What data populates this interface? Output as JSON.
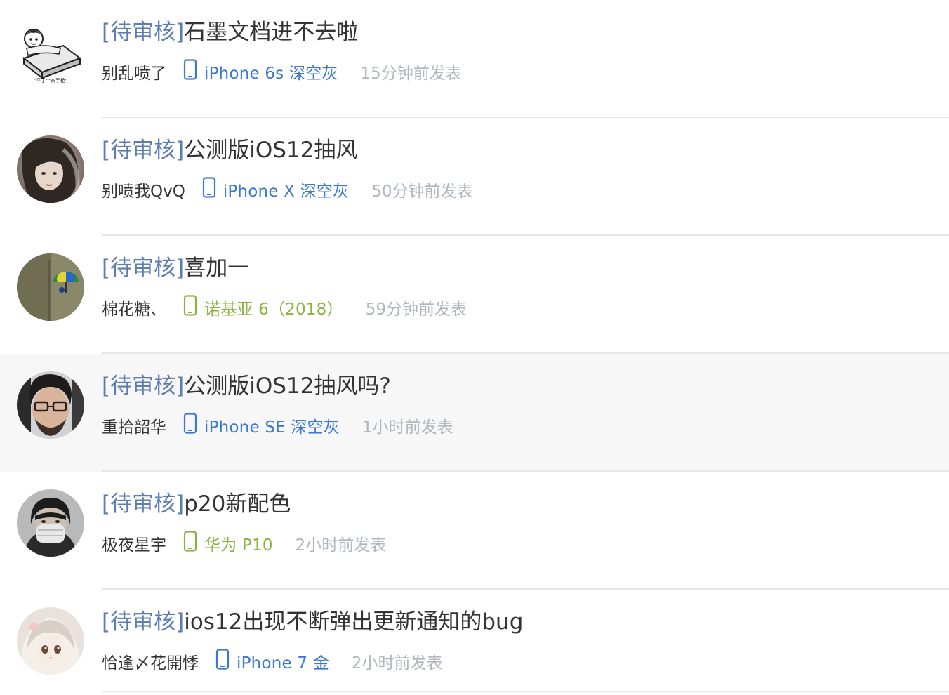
{
  "posts": [
    {
      "status": "[待审核]",
      "title": "石墨文档进不去啦",
      "author": "别乱喷了",
      "device": "iPhone 6s 深空灰",
      "device_color": "#3b78cf",
      "time": "15分钟前发表",
      "avatar": "meme-bed-avatar",
      "avatar_caption": "\"吓了个亲手枪\""
    },
    {
      "status": "[待审核]",
      "title": "公测版iOS12抽风",
      "author": "别喷我QvQ",
      "device": "iPhone X 深空灰",
      "device_color": "#3b78cf",
      "time": "50分钟前发表",
      "avatar": "girl-photo-avatar"
    },
    {
      "status": "[待审核]",
      "title": "喜加一",
      "author": "棉花糖、",
      "device": "诺基亚 6（2018）",
      "device_color": "#8ab33e",
      "time": "59分钟前发表",
      "avatar": "umbrella-photo-avatar"
    },
    {
      "status": "[待审核]",
      "title": "公测版iOS12抽风吗?",
      "author": "重拾韶华",
      "device": "iPhone SE 深空灰",
      "device_color": "#3b78cf",
      "time": "1小时前发表",
      "avatar": "man-glasses-avatar"
    },
    {
      "status": "[待审核]",
      "title": "p20新配色",
      "author": "极夜星宇",
      "device": "华为 P10",
      "device_color": "#8ab33e",
      "time": "2小时前发表",
      "avatar": "masked-person-avatar"
    },
    {
      "status": "[待审核]",
      "title": "ios12出现不断弹出更新通知的bug",
      "author": "恰逢〆花開悸",
      "device": "iPhone 7 金",
      "device_color": "#3b78cf",
      "time": "2小时前发表",
      "avatar": "anime-girl-avatar"
    }
  ]
}
